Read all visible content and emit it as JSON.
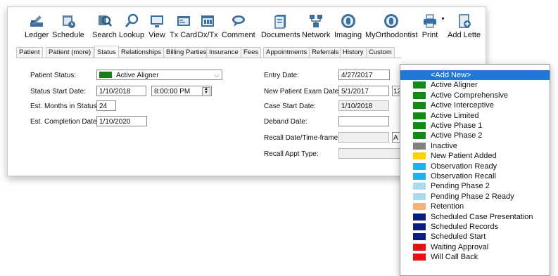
{
  "toolbar": [
    {
      "key": "ledger",
      "label": "Ledger",
      "icon": "ledger-icon"
    },
    {
      "key": "schedule",
      "label": "Schedule",
      "icon": "schedule-icon"
    },
    {
      "key": "search",
      "label": "Search",
      "icon": "search-icon"
    },
    {
      "key": "lookup",
      "label": "Lookup",
      "icon": "lookup-icon"
    },
    {
      "key": "view",
      "label": "View",
      "icon": "view-icon"
    },
    {
      "key": "tx-card",
      "label": "Tx Card",
      "icon": "tx-card-icon"
    },
    {
      "key": "dx-tx",
      "label": "Dx/Tx",
      "icon": "dx-tx-icon"
    },
    {
      "key": "comment",
      "label": "Comment",
      "icon": "comment-icon"
    },
    {
      "key": "documents",
      "label": "Documents",
      "icon": "documents-icon"
    },
    {
      "key": "network",
      "label": "Network",
      "icon": "network-icon"
    },
    {
      "key": "imaging",
      "label": "Imaging",
      "icon": "imaging-icon"
    },
    {
      "key": "myorthodontist",
      "label": "MyOrthodontist",
      "icon": "myorthodontist-icon"
    },
    {
      "key": "print",
      "label": "Print",
      "icon": "print-icon"
    },
    {
      "key": "add-letter",
      "label": "Add Lette",
      "icon": "add-letter-icon"
    }
  ],
  "tabs": [
    "Patient",
    "Patient (more)",
    "Status",
    "Relationships",
    "Billing Parties",
    "Insurance",
    "Fees",
    "Appointments",
    "Referrals",
    "History",
    "Custom"
  ],
  "active_tab": "Status",
  "form": {
    "patient_status_label": "Patient Status:",
    "patient_status_value": "Active Aligner",
    "patient_status_color": "#1a7f1a",
    "status_start_label": "Status Start Date:",
    "status_start_date": "1/10/2018",
    "status_start_time": "8:00:00 PM",
    "est_months_label": "Est. Months in Status:",
    "est_months_value": "24",
    "est_completion_label": "Est. Completion Date:",
    "est_completion_value": "1/10/2020",
    "entry_date_label": "Entry Date:",
    "entry_date_value": "4/27/2017",
    "new_patient_exam_label": "New Patient Exam Date:",
    "new_patient_exam_value": "5/1/2017",
    "new_patient_exam_extra": "12",
    "case_start_label": "Case Start Date:",
    "case_start_value": "1/10/2018",
    "deband_label": "Deband Date:",
    "deband_value": "",
    "recall_label": "Recall Date/Time-frame:",
    "recall_value": "",
    "recall_extra": "A",
    "recall_appt_label": "Recall Appt Type:",
    "recall_appt_value": ""
  },
  "status_options": [
    {
      "label": "<Add New>",
      "color": "",
      "highlighted": true
    },
    {
      "label": "Active Aligner",
      "color": "#138a13"
    },
    {
      "label": "Active Comprehensive",
      "color": "#138a13"
    },
    {
      "label": "Active Interceptive",
      "color": "#138a13"
    },
    {
      "label": "Active Limited",
      "color": "#138a13"
    },
    {
      "label": "Active Phase 1",
      "color": "#138a13"
    },
    {
      "label": "Active Phase 2",
      "color": "#138a13"
    },
    {
      "label": "Inactive",
      "color": "#808080"
    },
    {
      "label": "New Patient Added",
      "color": "#ffd200"
    },
    {
      "label": "Observation Ready",
      "color": "#19b4ee"
    },
    {
      "label": "Observation Recall",
      "color": "#19b4ee"
    },
    {
      "label": "Pending Phase 2",
      "color": "#a8dcea"
    },
    {
      "label": "Pending Phase 2 Ready",
      "color": "#a8dcea"
    },
    {
      "label": "Retention",
      "color": "#f7b27a"
    },
    {
      "label": "Scheduled Case Presentation",
      "color": "#0a1d80"
    },
    {
      "label": "Scheduled Records",
      "color": "#0a1d80"
    },
    {
      "label": "Scheduled Start",
      "color": "#0a1d80"
    },
    {
      "label": "Waiting Approval",
      "color": "#e81010"
    },
    {
      "label": "Will Call Back",
      "color": "#e81010"
    }
  ]
}
